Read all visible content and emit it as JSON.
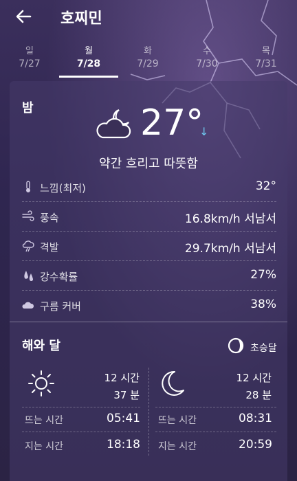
{
  "header": {
    "title": "호찌민",
    "back_icon": "back-arrow-icon"
  },
  "tabs": [
    {
      "day": "일",
      "date": "7/27"
    },
    {
      "day": "월",
      "date": "7/28",
      "active": true
    },
    {
      "day": "화",
      "date": "7/29"
    },
    {
      "day": "수",
      "date": "7/30"
    },
    {
      "day": "목",
      "date": "7/31"
    }
  ],
  "night": {
    "label": "밤",
    "condition_icon": "cloudy-night-icon",
    "temperature": "27°",
    "trend_arrow": "↓",
    "condition": "약간 흐리고 따뜻함"
  },
  "details": [
    {
      "icon": "thermometer-icon",
      "label": "느낌(최저)",
      "value": "32°"
    },
    {
      "icon": "wind-icon",
      "label": "풍속",
      "value": "16.8km/h 서남서"
    },
    {
      "icon": "gust-icon",
      "label": "격발",
      "value": "29.7km/h 서남서"
    },
    {
      "icon": "rain-drops-icon",
      "label": "강수확률",
      "value": "27%"
    },
    {
      "icon": "cloud-icon",
      "label": "구름 커버",
      "value": "38%"
    }
  ],
  "sun_moon": {
    "title": "해와 달",
    "moon_phase": "초승달",
    "sun": {
      "hours": "12 시간",
      "minutes": "37 분",
      "rise_label": "뜨는 시간",
      "rise": "05:41",
      "set_label": "지는 시간",
      "set": "18:18"
    },
    "moon": {
      "hours": "12 시간",
      "minutes": "28 분",
      "rise_label": "뜨는 시간",
      "rise": "08:31",
      "set_label": "지는 시간",
      "set": "20:59"
    }
  },
  "colors": {
    "background": "#2e2547",
    "trend_arrow": "#6fc8f0"
  }
}
